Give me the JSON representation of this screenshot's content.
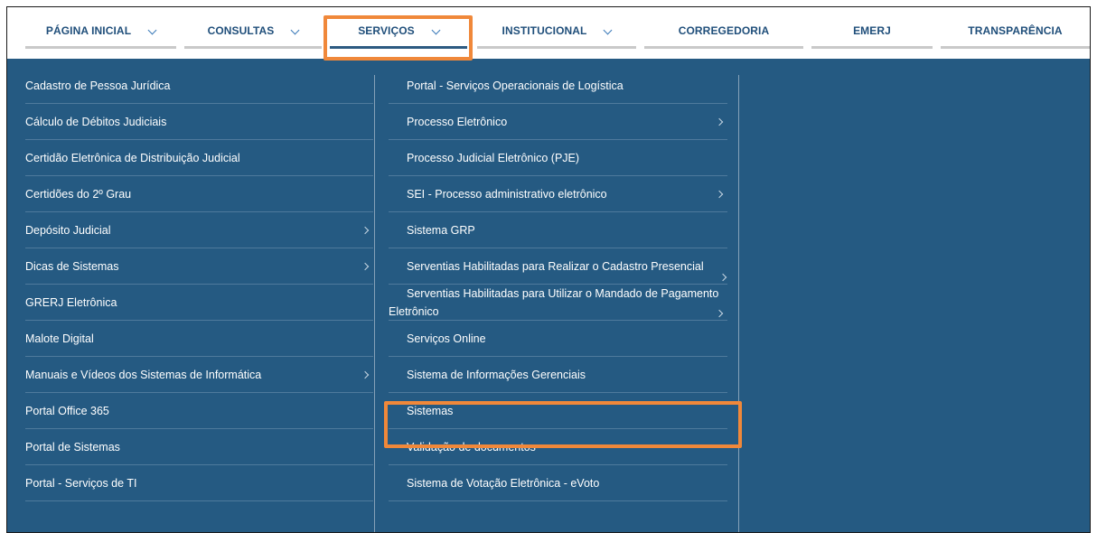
{
  "nav": {
    "items": [
      {
        "label": "PÁGINA INICIAL",
        "dropdown": true
      },
      {
        "label": "CONSULTAS",
        "dropdown": true
      },
      {
        "label": "SERVIÇOS",
        "dropdown": true,
        "active": true
      },
      {
        "label": "INSTITUCIONAL",
        "dropdown": true
      },
      {
        "label": "CORREGEDORIA",
        "dropdown": false
      },
      {
        "label": "EMERJ",
        "dropdown": false
      },
      {
        "label": "TRANSPARÊNCIA",
        "dropdown": false
      }
    ]
  },
  "menu": {
    "left": [
      {
        "label": "Cadastro de Pessoa Jurídica",
        "submenu": false
      },
      {
        "label": "Cálculo de Débitos Judiciais",
        "submenu": false
      },
      {
        "label": "Certidão Eletrônica de Distribuição Judicial",
        "submenu": false
      },
      {
        "label": "Certidões do 2º Grau",
        "submenu": false
      },
      {
        "label": "Depósito Judicial",
        "submenu": true
      },
      {
        "label": "Dicas de Sistemas",
        "submenu": true
      },
      {
        "label": "GRERJ Eletrônica",
        "submenu": false
      },
      {
        "label": "Malote Digital",
        "submenu": false
      },
      {
        "label": "Manuais e Vídeos dos Sistemas de Informática",
        "submenu": true
      },
      {
        "label": "Portal Office 365",
        "submenu": false
      },
      {
        "label": "Portal de Sistemas",
        "submenu": false
      },
      {
        "label": "Portal - Serviços de TI",
        "submenu": false
      }
    ],
    "middle": [
      {
        "label": "Portal - Serviços Operacionais de Logística",
        "submenu": false
      },
      {
        "label": "Processo Eletrônico",
        "submenu": true
      },
      {
        "label": "Processo Judicial Eletrônico (PJE)",
        "submenu": false
      },
      {
        "label": "SEI - Processo administrativo eletrônico",
        "submenu": true
      },
      {
        "label": "Sistema GRP",
        "submenu": false
      },
      {
        "label": "Serventias Habilitadas para Realizar o Cadastro Presencial",
        "submenu": true
      },
      {
        "label": "Serventias Habilitadas para Utilizar o Mandado de Pagamento Eletrônico",
        "submenu": true
      },
      {
        "label": "Serviços Online",
        "submenu": false
      },
      {
        "label": "Sistema de Informações Gerenciais",
        "submenu": false
      },
      {
        "label": "Sistemas",
        "submenu": false,
        "highlighted": true
      },
      {
        "label": "Validação de documentos",
        "submenu": false
      },
      {
        "label": "Sistema de Votação Eletrônica - eVoto",
        "submenu": false
      }
    ]
  },
  "colors": {
    "nav_text": "#1f4e7a",
    "panel_bg": "#255a82",
    "highlight": "#f0883a"
  }
}
